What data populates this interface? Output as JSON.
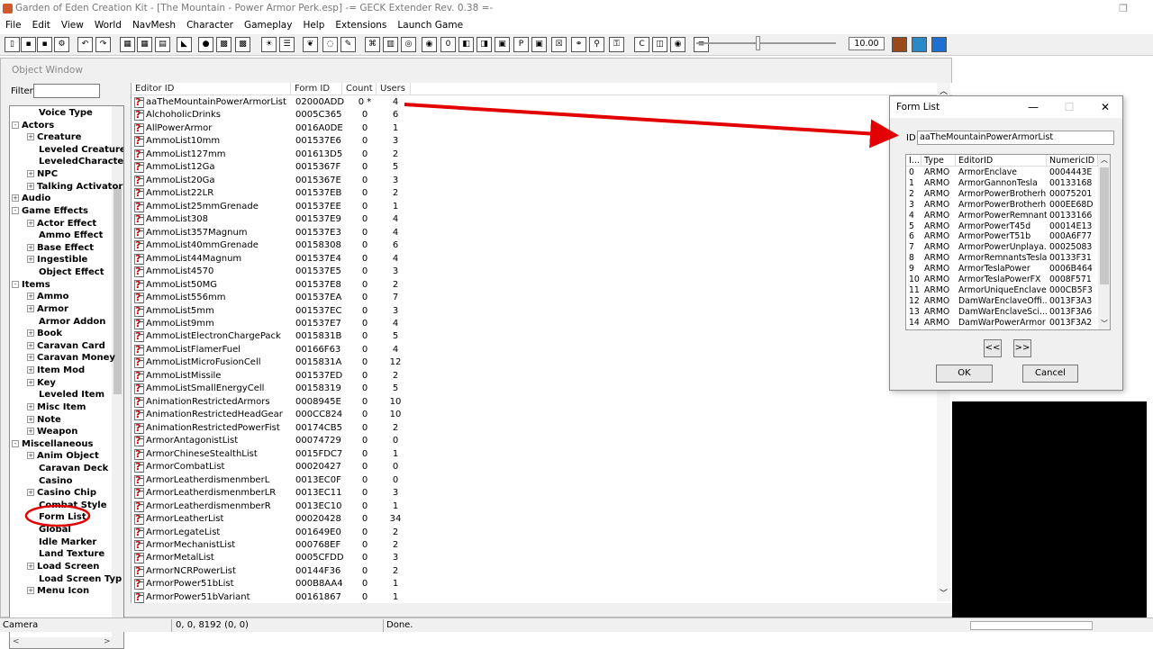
{
  "window": {
    "title": "Garden of Eden Creation Kit - [The Mountain - Power Armor Perk.esp] -= GECK Extender Rev. 0.38 =-"
  },
  "menu": [
    "File",
    "Edit",
    "View",
    "World",
    "NavMesh",
    "Character",
    "Gameplay",
    "Help",
    "Extensions",
    "Launch Game"
  ],
  "toolbar": {
    "zoom_value": "10.00"
  },
  "object_window": {
    "title": "Object Window",
    "filter_label": "Filter",
    "filter_value": "",
    "tree": [
      {
        "label": "Voice Type",
        "level": 2,
        "expander": ""
      },
      {
        "label": "Actors",
        "level": 0,
        "expander": "-"
      },
      {
        "label": "Creature",
        "level": 1,
        "expander": "+"
      },
      {
        "label": "Leveled Creature",
        "level": 2,
        "expander": ""
      },
      {
        "label": "LeveledCharacte",
        "level": 2,
        "expander": ""
      },
      {
        "label": "NPC",
        "level": 1,
        "expander": "+"
      },
      {
        "label": "Talking Activator",
        "level": 1,
        "expander": "+"
      },
      {
        "label": "Audio",
        "level": 0,
        "expander": "+"
      },
      {
        "label": "Game Effects",
        "level": 0,
        "expander": "-"
      },
      {
        "label": "Actor Effect",
        "level": 1,
        "expander": "+"
      },
      {
        "label": "Ammo Effect",
        "level": 2,
        "expander": ""
      },
      {
        "label": "Base Effect",
        "level": 1,
        "expander": "+"
      },
      {
        "label": "Ingestible",
        "level": 1,
        "expander": "+"
      },
      {
        "label": "Object Effect",
        "level": 2,
        "expander": ""
      },
      {
        "label": "Items",
        "level": 0,
        "expander": "-"
      },
      {
        "label": "Ammo",
        "level": 1,
        "expander": "+"
      },
      {
        "label": "Armor",
        "level": 1,
        "expander": "+"
      },
      {
        "label": "Armor Addon",
        "level": 2,
        "expander": ""
      },
      {
        "label": "Book",
        "level": 1,
        "expander": "+"
      },
      {
        "label": "Caravan Card",
        "level": 1,
        "expander": "+"
      },
      {
        "label": "Caravan Money",
        "level": 1,
        "expander": "+"
      },
      {
        "label": "Item Mod",
        "level": 1,
        "expander": "+"
      },
      {
        "label": "Key",
        "level": 1,
        "expander": "+"
      },
      {
        "label": "Leveled Item",
        "level": 2,
        "expander": ""
      },
      {
        "label": "Misc Item",
        "level": 1,
        "expander": "+"
      },
      {
        "label": "Note",
        "level": 1,
        "expander": "+"
      },
      {
        "label": "Weapon",
        "level": 1,
        "expander": "+"
      },
      {
        "label": "Miscellaneous",
        "level": 0,
        "expander": "-"
      },
      {
        "label": "Anim Object",
        "level": 1,
        "expander": "+"
      },
      {
        "label": "Caravan Deck",
        "level": 2,
        "expander": ""
      },
      {
        "label": "Casino",
        "level": 2,
        "expander": ""
      },
      {
        "label": "Casino Chip",
        "level": 1,
        "expander": "+"
      },
      {
        "label": "Combat Style",
        "level": 2,
        "expander": ""
      },
      {
        "label": "Form List",
        "level": 2,
        "expander": ""
      },
      {
        "label": "Global",
        "level": 2,
        "expander": ""
      },
      {
        "label": "Idle Marker",
        "level": 2,
        "expander": ""
      },
      {
        "label": "Land Texture",
        "level": 2,
        "expander": ""
      },
      {
        "label": "Load Screen",
        "level": 1,
        "expander": "+"
      },
      {
        "label": "Load Screen Typ",
        "level": 2,
        "expander": ""
      },
      {
        "label": "Menu Icon",
        "level": 1,
        "expander": "+"
      }
    ],
    "list_headers": [
      "Editor ID",
      "Form ID",
      "Count",
      "Users"
    ],
    "rows": [
      [
        "aaTheMountainPowerArmorList",
        "02000ADD",
        "0 *",
        "4"
      ],
      [
        "AlchoholicDrinks",
        "0005C365",
        "0",
        "6"
      ],
      [
        "AllPowerArmor",
        "0016A0DE",
        "0",
        "1"
      ],
      [
        "AmmoList10mm",
        "001537E6",
        "0",
        "3"
      ],
      [
        "AmmoList127mm",
        "001613D5",
        "0",
        "2"
      ],
      [
        "AmmoList12Ga",
        "0015367F",
        "0",
        "5"
      ],
      [
        "AmmoList20Ga",
        "0015367E",
        "0",
        "3"
      ],
      [
        "AmmoList22LR",
        "001537EB",
        "0",
        "2"
      ],
      [
        "AmmoList25mmGrenade",
        "001537EE",
        "0",
        "1"
      ],
      [
        "AmmoList308",
        "001537E9",
        "0",
        "4"
      ],
      [
        "AmmoList357Magnum",
        "001537E3",
        "0",
        "4"
      ],
      [
        "AmmoList40mmGrenade",
        "00158308",
        "0",
        "6"
      ],
      [
        "AmmoList44Magnum",
        "001537E4",
        "0",
        "4"
      ],
      [
        "AmmoList4570",
        "001537E5",
        "0",
        "3"
      ],
      [
        "AmmoList50MG",
        "001537E8",
        "0",
        "2"
      ],
      [
        "AmmoList556mm",
        "001537EA",
        "0",
        "7"
      ],
      [
        "AmmoList5mm",
        "001537EC",
        "0",
        "3"
      ],
      [
        "AmmoList9mm",
        "001537E7",
        "0",
        "4"
      ],
      [
        "AmmoListElectronChargePack",
        "0015831B",
        "0",
        "5"
      ],
      [
        "AmmoListFlamerFuel",
        "00166F63",
        "0",
        "4"
      ],
      [
        "AmmoListMicroFusionCell",
        "0015831A",
        "0",
        "12"
      ],
      [
        "AmmoListMissile",
        "001537ED",
        "0",
        "2"
      ],
      [
        "AmmoListSmallEnergyCell",
        "00158319",
        "0",
        "5"
      ],
      [
        "AnimationRestrictedArmors",
        "0008945E",
        "0",
        "10"
      ],
      [
        "AnimationRestrictedHeadGear",
        "000CC824",
        "0",
        "10"
      ],
      [
        "AnimationRestrictedPowerFist",
        "00174CB5",
        "0",
        "2"
      ],
      [
        "ArmorAntagonistList",
        "00074729",
        "0",
        "0"
      ],
      [
        "ArmorChineseStealthList",
        "0015FDC7",
        "0",
        "1"
      ],
      [
        "ArmorCombatList",
        "00020427",
        "0",
        "0"
      ],
      [
        "ArmorLeatherdismenmberL",
        "0013EC0F",
        "0",
        "0"
      ],
      [
        "ArmorLeatherdismenmberLR",
        "0013EC11",
        "0",
        "3"
      ],
      [
        "ArmorLeatherdismenmberR",
        "0013EC10",
        "0",
        "1"
      ],
      [
        "ArmorLeatherList",
        "00020428",
        "0",
        "34"
      ],
      [
        "ArmorLegateList",
        "001649E0",
        "0",
        "2"
      ],
      [
        "ArmorMechanistList",
        "000768EF",
        "0",
        "2"
      ],
      [
        "ArmorMetalList",
        "0005CFDD",
        "0",
        "3"
      ],
      [
        "ArmorNCRPowerList",
        "00144F36",
        "0",
        "2"
      ],
      [
        "ArmorPower51bList",
        "000B8AA4",
        "0",
        "1"
      ],
      [
        "ArmorPower51bVariant",
        "00161867",
        "0",
        "1"
      ]
    ]
  },
  "status": {
    "left": "Camera",
    "coords": "0, 0, 8192 (0, 0)",
    "message": "Done."
  },
  "dialog": {
    "title": "Form List",
    "id_label": "ID",
    "id_value": "aaTheMountainPowerArmorList",
    "headers": [
      "I...",
      "Type",
      "EditorID",
      "NumericID"
    ],
    "rows": [
      [
        "0",
        "ARMO",
        "ArmorEnclave",
        "0004443E"
      ],
      [
        "1",
        "ARMO",
        "ArmorGannonTesla",
        "00133168"
      ],
      [
        "2",
        "ARMO",
        "ArmorPowerBrotherh...",
        "00075201"
      ],
      [
        "3",
        "ARMO",
        "ArmorPowerBrotherh...",
        "000EE68D"
      ],
      [
        "4",
        "ARMO",
        "ArmorPowerRemnants",
        "00133166"
      ],
      [
        "5",
        "ARMO",
        "ArmorPowerT45d",
        "00014E13"
      ],
      [
        "6",
        "ARMO",
        "ArmorPowerT51b",
        "000A6F77"
      ],
      [
        "7",
        "ARMO",
        "ArmorPowerUnplaya...",
        "00025083"
      ],
      [
        "8",
        "ARMO",
        "ArmorRemnantsTesla",
        "00133F31"
      ],
      [
        "9",
        "ARMO",
        "ArmorTeslaPower",
        "0006B464"
      ],
      [
        "10",
        "ARMO",
        "ArmorTeslaPowerFX",
        "0008F571"
      ],
      [
        "11",
        "ARMO",
        "ArmorUniqueEnclave",
        "000CB5F3"
      ],
      [
        "12",
        "ARMO",
        "DamWarEnclaveOffi...",
        "0013F3A3"
      ],
      [
        "13",
        "ARMO",
        "DamWarEnclaveSci...",
        "0013F3A6"
      ],
      [
        "14",
        "ARMO",
        "DamWarPowerArmor",
        "0013F3A2"
      ]
    ],
    "prev_label": "<<",
    "next_label": ">>",
    "ok_label": "OK",
    "cancel_label": "Cancel"
  },
  "colors": {
    "annotation": "#e30000",
    "toolbar_bg": "#f0f0f0",
    "selected_bg": "#ffffff"
  }
}
